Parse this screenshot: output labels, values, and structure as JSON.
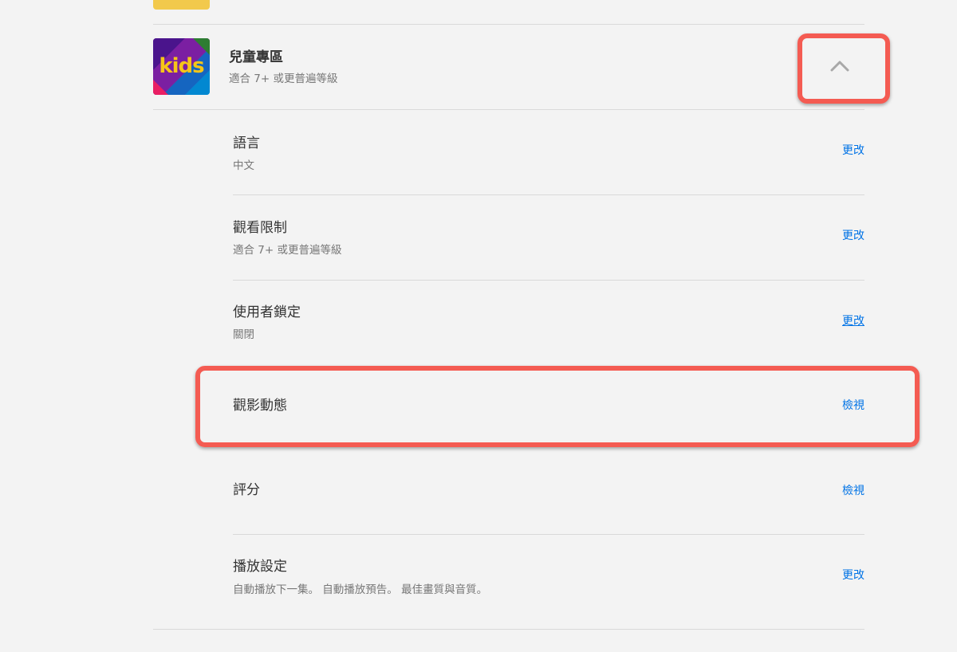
{
  "profile": {
    "avatar_text": "kids",
    "name": "兒童專區",
    "subtitle": "適合 7+ 或更普遍等級",
    "collapse_icon": "chevron-up-icon"
  },
  "settings": [
    {
      "title": "語言",
      "description": "中文",
      "action": "更改"
    },
    {
      "title": "觀看限制",
      "description": "適合 7+ 或更普遍等級",
      "action": "更改"
    },
    {
      "title": "使用者鎖定",
      "description": "關閉",
      "action": "更改"
    },
    {
      "title": "觀影動態",
      "description": "",
      "action": "檢視"
    },
    {
      "title": "評分",
      "description": "",
      "action": "檢視"
    },
    {
      "title": "播放設定",
      "description": "自動播放下一集。 自動播放預告。 最佳畫質與音質。",
      "action": "更改"
    }
  ],
  "colors": {
    "background": "#f3f3f3",
    "link": "#0073e6",
    "highlight": "#f45b52",
    "prev_avatar": "#f2c94c",
    "kids_text": "#f5c518"
  }
}
